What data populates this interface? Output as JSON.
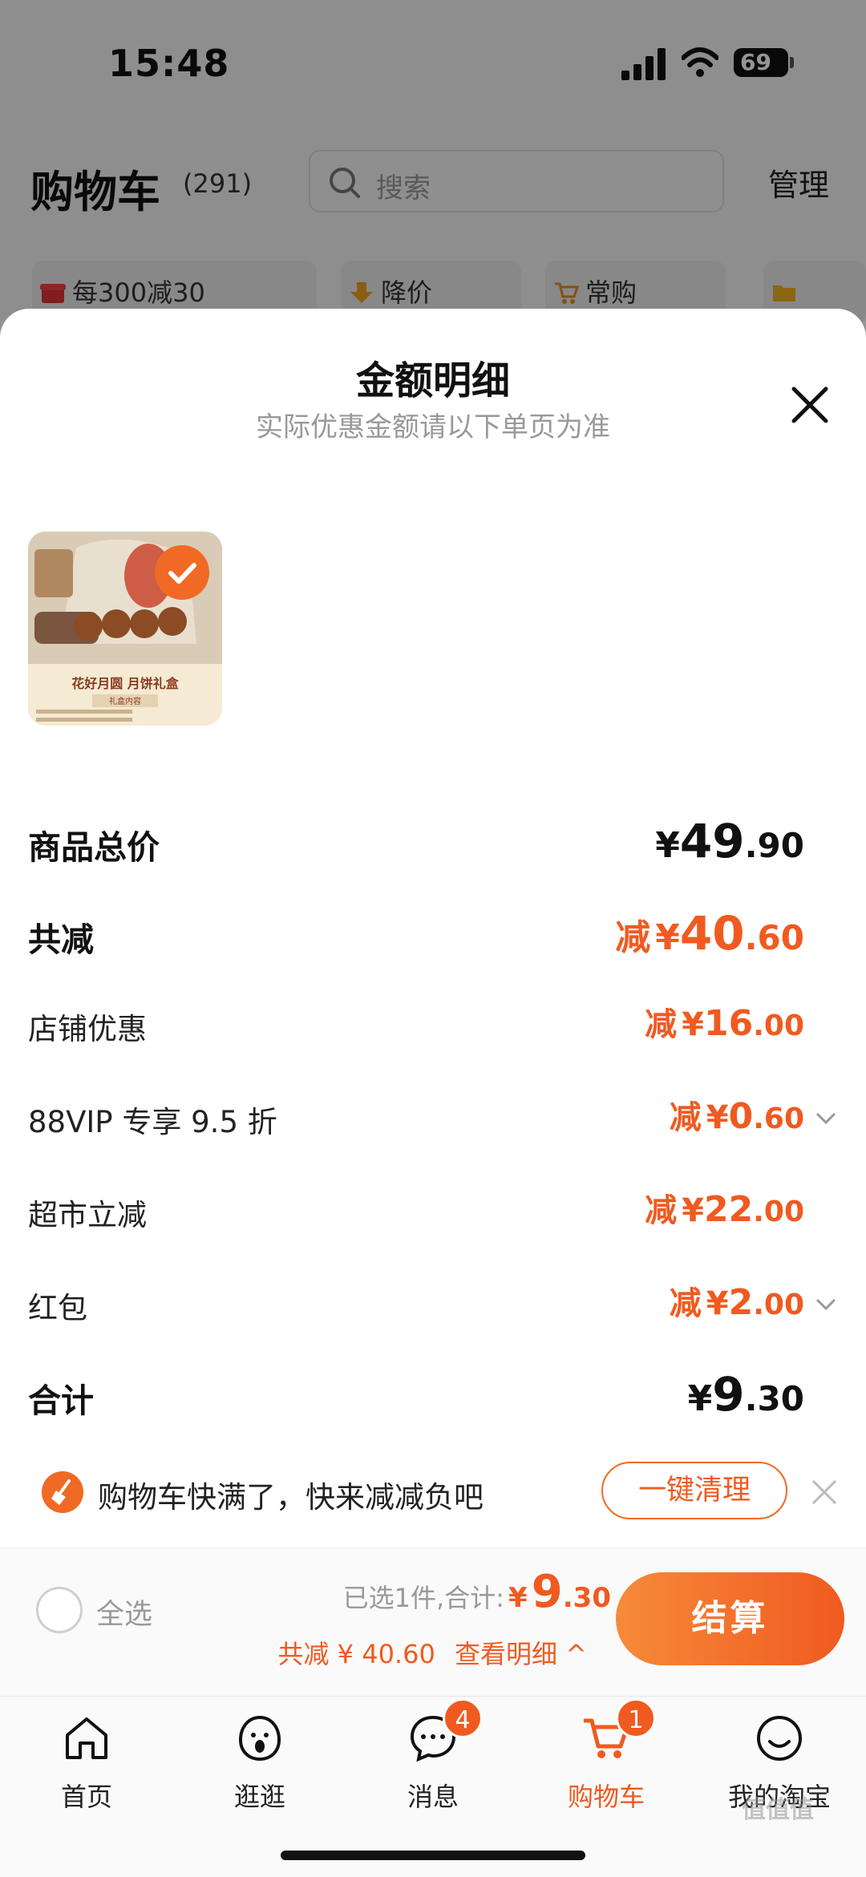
{
  "status_bar": {
    "time": "15:48",
    "battery": "69"
  },
  "header": {
    "title": "购物车",
    "count": "(291)",
    "search_placeholder": "搜索",
    "manage": "管理"
  },
  "chips": [
    {
      "label": "每300减30",
      "icon": "gift-box-icon"
    },
    {
      "label": "降价",
      "icon": "price-drop-icon"
    },
    {
      "label": "常购",
      "icon": "cart-icon"
    },
    {
      "label": "",
      "icon": "folder-icon"
    }
  ],
  "sheet": {
    "title": "金额明细",
    "subtitle": "实际优惠金额请以下单页为准",
    "product": {
      "name": "花好月圆 月饼礼盒",
      "sub": "礼盒内容",
      "selected": true
    },
    "rows": [
      {
        "label": "商品总价",
        "prefix": "",
        "symbol": "¥",
        "integer": "49",
        "decimal": ".90"
      },
      {
        "label": "共减",
        "prefix": "减",
        "symbol": "¥",
        "integer": "40",
        "decimal": ".60"
      },
      {
        "label": "店铺优惠",
        "prefix": "减",
        "symbol": "¥",
        "integer": "16",
        "decimal": ".00"
      },
      {
        "label": "88VIP 专享 9.5 折",
        "prefix": "减",
        "symbol": "¥",
        "integer": "0",
        "decimal": ".60"
      },
      {
        "label": "超市立减",
        "prefix": "减",
        "symbol": "¥",
        "integer": "22",
        "decimal": ".00"
      },
      {
        "label": "红包",
        "prefix": "减",
        "symbol": "¥",
        "integer": "2",
        "decimal": ".00"
      },
      {
        "label": "合计",
        "prefix": "",
        "symbol": "¥",
        "integer": "9",
        "decimal": ".30"
      }
    ]
  },
  "tip": {
    "text": "购物车快满了，快来减减负吧",
    "button": "一键清理"
  },
  "checkout": {
    "select_all": "全选",
    "selected_label": "已选1件,合计:",
    "symbol": "¥",
    "integer": "9",
    "decimal": ".30",
    "discount": "共减 ¥ 40.60",
    "detail_link": "查看明细 ^",
    "button": "结算"
  },
  "tabs": [
    {
      "label": "首页",
      "icon": "home-icon"
    },
    {
      "label": "逛逛",
      "icon": "browse-icon"
    },
    {
      "label": "消息",
      "icon": "message-icon",
      "badge": "4"
    },
    {
      "label": "购物车",
      "icon": "cart-icon",
      "badge": "1",
      "active": true
    },
    {
      "label": "我的淘宝",
      "icon": "profile-icon"
    }
  ],
  "watermark": "值值值",
  "colors": {
    "accent": "#f05a20",
    "accent_light": "#f78a3a",
    "overlay": "#000000"
  }
}
